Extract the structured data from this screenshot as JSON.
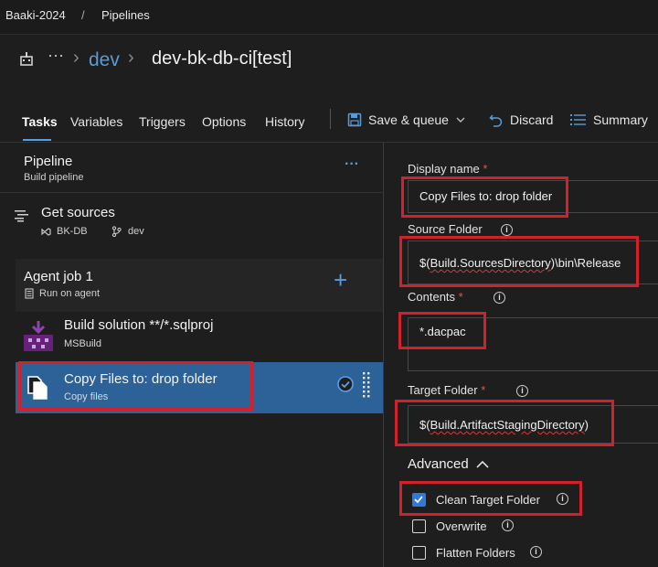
{
  "topbar": {
    "project": "Baaki-2024",
    "separator": "/",
    "section": "Pipelines"
  },
  "header": {
    "ellipsis": "···",
    "chevron": "›",
    "folder": "dev",
    "pipeline_name": "dev-bk-db-ci[test]"
  },
  "tabs": [
    {
      "label": "Tasks"
    },
    {
      "label": "Variables"
    },
    {
      "label": "Triggers"
    },
    {
      "label": "Options"
    },
    {
      "label": "History"
    }
  ],
  "toolbar": {
    "save_queue": "Save & queue",
    "discard": "Discard",
    "summary": "Summary"
  },
  "pipeline": {
    "title": "Pipeline",
    "subtitle": "Build pipeline",
    "more": "···"
  },
  "get_sources": {
    "title": "Get sources",
    "repo": "BK-DB",
    "branch": "dev"
  },
  "agent_job": {
    "title": "Agent job 1",
    "subtitle": "Run on agent",
    "add": "+"
  },
  "tasks": [
    {
      "title": "Build solution **/*.sqlproj",
      "subtitle": "MSBuild"
    },
    {
      "title": "Copy Files to: drop folder",
      "subtitle": "Copy files"
    }
  ],
  "form": {
    "display_name": {
      "label": "Display name",
      "value": "Copy Files to: drop folder",
      "required": "*"
    },
    "source_folder": {
      "label": "Source Folder",
      "value_prefix": "$(",
      "value_var": "Build.SourcesDirectory",
      "value_suffix": ")\\bin\\Release"
    },
    "contents": {
      "label": "Contents",
      "value": "*.dacpac",
      "required": "*"
    },
    "target_folder": {
      "label": "Target Folder",
      "value_prefix": "$(",
      "value_var": "Build.ArtifactStagingDirectory",
      "value_suffix": ")",
      "required": "*"
    },
    "advanced": {
      "label": "Advanced"
    },
    "clean_target": {
      "label": "Clean Target Folder",
      "checked": true
    },
    "overwrite": {
      "label": "Overwrite",
      "checked": false
    },
    "flatten": {
      "label": "Flatten Folders",
      "checked": false
    }
  },
  "colors": {
    "accent": "#2f7ad8",
    "selected_row": "#2d6299",
    "highlight_box": "#d4202a",
    "required": "#e05555"
  }
}
